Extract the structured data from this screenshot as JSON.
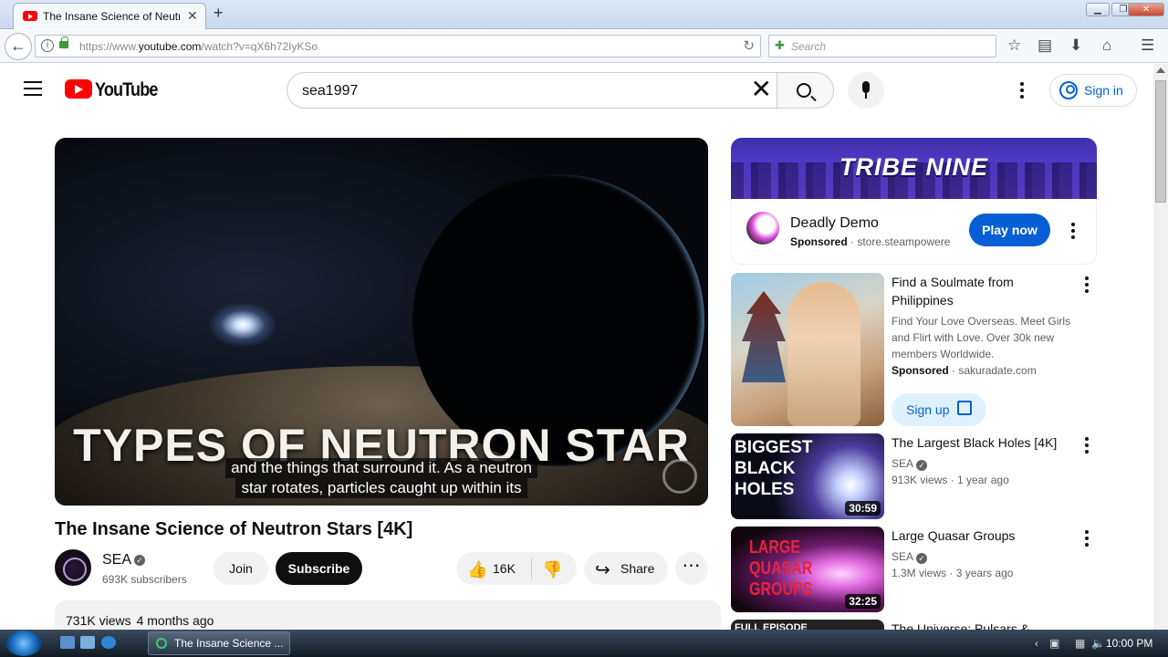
{
  "browser": {
    "tab_title": "The Insane Science of Neutr",
    "url_prefix": "https://www.",
    "url_domain": "youtube.com",
    "url_path": "/watch?v=qX6h72IyKSo",
    "search_placeholder": "Search"
  },
  "header": {
    "logo_text": "YouTube",
    "search_value": "sea1997",
    "sign_in": "Sign in"
  },
  "video": {
    "overlay_title": "TYPES OF NEUTRON STAR",
    "caption_line1": "and the things that surround it. As a neutron",
    "caption_line2": "star rotates, particles caught up within its",
    "title": "The Insane Science of Neutron Stars [4K]",
    "channel": "SEA",
    "subscribers": "693K subscribers",
    "join": "Join",
    "subscribe": "Subscribe",
    "likes": "16K",
    "share": "Share",
    "views": "731K views",
    "age": "4 months ago"
  },
  "ad": {
    "banner_title": "TRIBE NINE",
    "name": "Deadly Demo",
    "sponsored": "Sponsored",
    "domain": "store.steampowere",
    "cta": "Play now"
  },
  "sidebar": {
    "items": [
      {
        "title_l1": "Find a Soulmate from",
        "title_l2": "Philippines",
        "desc_l1": "Find Your Love Overseas. Meet Girls",
        "desc_l2": "and Flirt with Love. Over 30k new",
        "desc_l3": "members Worldwide.",
        "sponsored": "Sponsored",
        "domain": "sakuradate.com",
        "cta": "Sign up"
      },
      {
        "thumb_l1": "BIGGEST",
        "thumb_l2": "BLACK",
        "thumb_l3": "HOLES",
        "duration": "30:59",
        "title": "The Largest Black Holes [4K]",
        "channel": "SEA",
        "views": "913K views",
        "age": "1 year ago"
      },
      {
        "thumb_l1": "LARGE",
        "thumb_l2": "QUASAR",
        "thumb_l3": "GROUPS",
        "duration": "32:25",
        "title": "Large Quasar Groups",
        "channel": "SEA",
        "views": "1.3M views",
        "age": "3 years ago"
      },
      {
        "thumb_l1": "FULL EPISODE",
        "title": "The Universe: Pulsars &"
      }
    ]
  },
  "taskbar": {
    "task_title": "The Insane Science ...",
    "clock": "10:00 PM"
  }
}
